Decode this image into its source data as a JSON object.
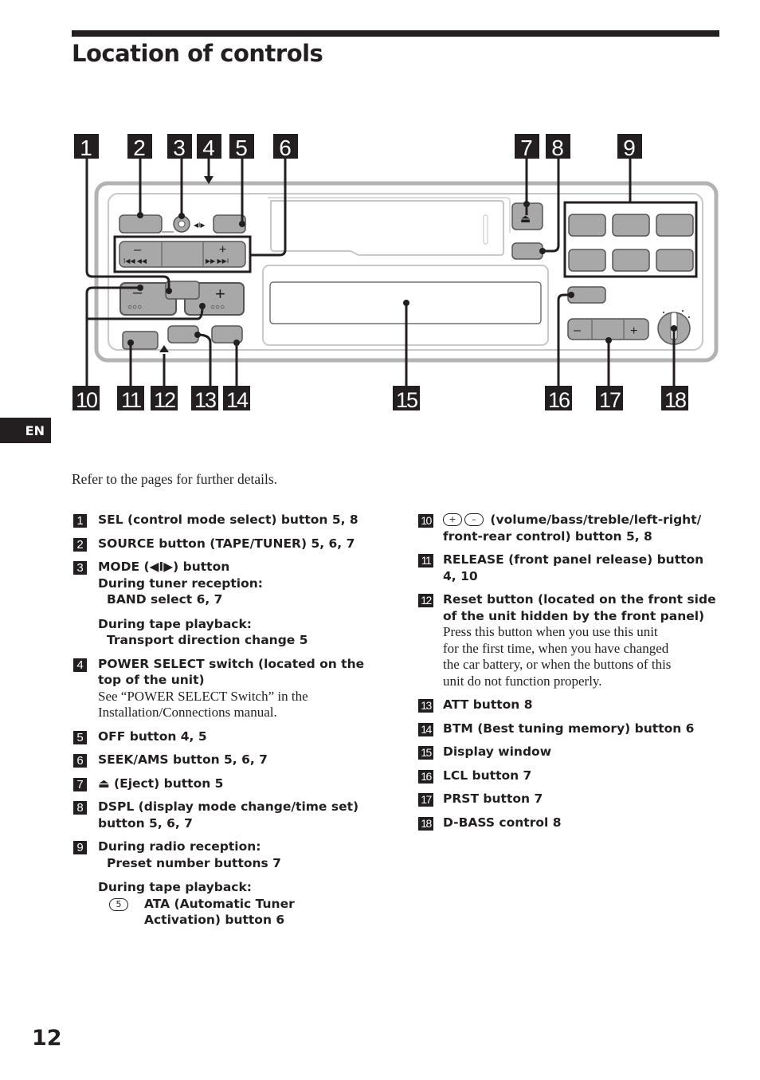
{
  "page": {
    "title": "Location of controls",
    "language_tab": "EN",
    "intro": "Refer to the pages for further details.",
    "page_number": "12"
  },
  "diagram": {
    "callouts_top": [
      "1",
      "2",
      "3",
      "4",
      "5",
      "6",
      "7",
      "8",
      "9"
    ],
    "callouts_bottom": [
      "10",
      "11",
      "12",
      "13",
      "14",
      "15",
      "16",
      "17",
      "18"
    ],
    "glyphs": {
      "minus": "–",
      "plus": "+",
      "prev": "I◀◀ ◀◀",
      "next": "▶▶ ▶▶I",
      "dots": "○○○",
      "mode": "◀I▶",
      "eject": "⏏"
    }
  },
  "left_column": [
    {
      "num": "1",
      "lines": [
        {
          "t": "b",
          "text": "SEL (control mode select) button 5, 8"
        }
      ]
    },
    {
      "num": "2",
      "lines": [
        {
          "t": "b",
          "text": "SOURCE button (TAPE/TUNER) 5, 6, 7"
        }
      ]
    },
    {
      "num": "3",
      "lines": [
        {
          "t": "b",
          "text": "MODE (◀I▶) button"
        },
        {
          "t": "b",
          "text": "During tuner reception:"
        },
        {
          "t": "bi",
          "text": "BAND select 6, 7"
        },
        {
          "t": "gap"
        },
        {
          "t": "b",
          "text": "During tape playback:"
        },
        {
          "t": "bi",
          "text": "Transport direction change 5"
        }
      ]
    },
    {
      "num": "4",
      "lines": [
        {
          "t": "b",
          "text": "POWER SELECT switch (located on the"
        },
        {
          "t": "b",
          "text": "top of the unit)"
        },
        {
          "t": "s",
          "text": "See “POWER SELECT Switch” in the"
        },
        {
          "t": "s",
          "text": "Installation/Connections manual."
        }
      ]
    },
    {
      "num": "5",
      "lines": [
        {
          "t": "b",
          "text": "OFF button 4, 5"
        }
      ]
    },
    {
      "num": "6",
      "lines": [
        {
          "t": "b",
          "text": "SEEK/AMS button 5, 6, 7"
        }
      ]
    },
    {
      "num": "7",
      "lines": [
        {
          "t": "b",
          "text": "⏏ (Eject) button 5"
        }
      ]
    },
    {
      "num": "8",
      "lines": [
        {
          "t": "b",
          "text": "DSPL (display mode change/time set)"
        },
        {
          "t": "b",
          "text": "button 5, 6, 7"
        }
      ]
    },
    {
      "num": "9",
      "lines": [
        {
          "t": "b",
          "text": "During radio reception:"
        },
        {
          "t": "bi",
          "text": "Preset number buttons 7"
        },
        {
          "t": "gap"
        },
        {
          "t": "b",
          "text": "During tape playback:"
        },
        {
          "t": "ata",
          "circle": "5",
          "text": "ATA (Automatic Tuner"
        },
        {
          "t": "ata",
          "text": "Activation) button 6"
        }
      ]
    }
  ],
  "right_column": [
    {
      "num": "10",
      "lines": [
        {
          "t": "pm",
          "circles": [
            "+",
            "–"
          ],
          "text": " (volume/bass/treble/left-right/"
        },
        {
          "t": "b",
          "text": "front-rear control) button 5, 8"
        }
      ]
    },
    {
      "num": "11",
      "lines": [
        {
          "t": "b",
          "text": "RELEASE (front panel release) button"
        },
        {
          "t": "b",
          "text": "4, 10"
        }
      ]
    },
    {
      "num": "12",
      "lines": [
        {
          "t": "b",
          "text": "Reset button (located on the front side"
        },
        {
          "t": "b",
          "text": "of the unit hidden by the front panel)"
        },
        {
          "t": "s",
          "text": "Press this button when you use this unit"
        },
        {
          "t": "s",
          "text": "for the first time, when you have changed"
        },
        {
          "t": "s",
          "text": "the car battery, or when the buttons of this"
        },
        {
          "t": "s",
          "text": "unit do not function properly."
        }
      ]
    },
    {
      "num": "13",
      "lines": [
        {
          "t": "b",
          "text": "ATT button 8"
        }
      ]
    },
    {
      "num": "14",
      "lines": [
        {
          "t": "b",
          "text": "BTM (Best tuning memory) button 6"
        }
      ]
    },
    {
      "num": "15",
      "lines": [
        {
          "t": "b",
          "text": "Display window"
        }
      ]
    },
    {
      "num": "16",
      "lines": [
        {
          "t": "b",
          "text": "LCL button 7"
        }
      ]
    },
    {
      "num": "17",
      "lines": [
        {
          "t": "b",
          "text": "PRST button 7"
        }
      ]
    },
    {
      "num": "18",
      "lines": [
        {
          "t": "b",
          "text": "D-BASS control 8"
        }
      ]
    }
  ]
}
